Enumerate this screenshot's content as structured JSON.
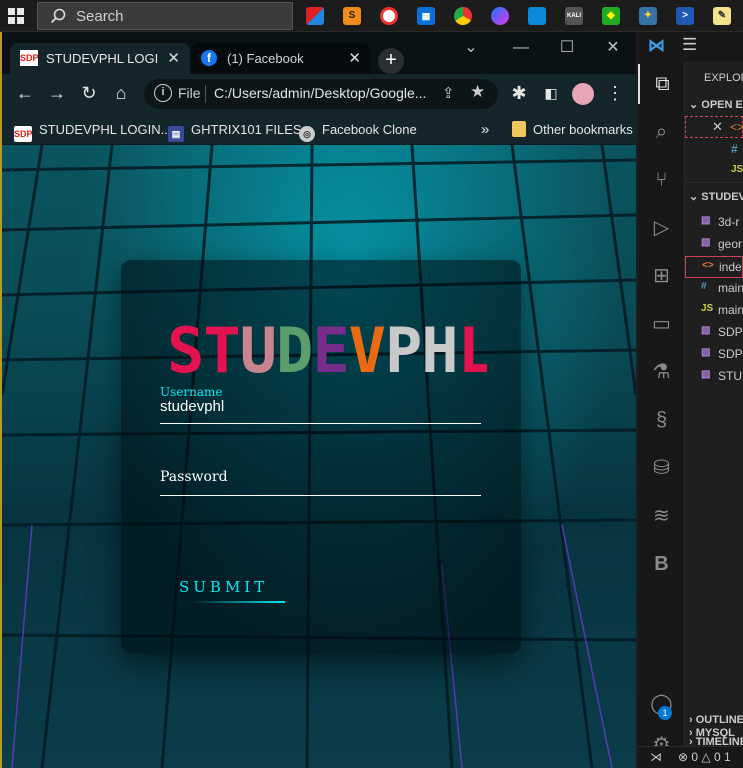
{
  "taskbar": {
    "search_placeholder": "Search"
  },
  "browser": {
    "tabs": [
      {
        "label": "STUDEVPHL LOGIN FO",
        "favicon": "SDP"
      },
      {
        "label": "(1) Facebook"
      }
    ],
    "address": {
      "scheme_label": "File",
      "url": "C:/Users/admin/Desktop/Google..."
    },
    "bookmarks": [
      {
        "label": "STUDEVPHL LOGIN...",
        "favicon": "SDP"
      },
      {
        "label": "GHTRIX101 FILES"
      },
      {
        "label": "Facebook Clone"
      }
    ],
    "bookmarks_overflow": "»",
    "other_bookmarks": "Other bookmarks"
  },
  "login": {
    "logo_letters": [
      {
        "ch": "S",
        "color": "#e3134f"
      },
      {
        "ch": "T",
        "color": "#e3134f"
      },
      {
        "ch": "U",
        "color": "#c9848f"
      },
      {
        "ch": "D",
        "color": "#5c9e6b"
      },
      {
        "ch": "E",
        "color": "#7a2c8c"
      },
      {
        "ch": "V",
        "color": "#e86a12"
      },
      {
        "ch": "P",
        "color": "#c9c9c9"
      },
      {
        "ch": "H",
        "color": "#c9c9c9"
      },
      {
        "ch": "L",
        "color": "#e3134f"
      }
    ],
    "username_label": "Username",
    "username_value": "studevphl",
    "password_label": "Password",
    "submit_label": "SUBMIT"
  },
  "vscode": {
    "explorer_title": "EXPLORER",
    "open_editors_label": "OPEN EDITORS",
    "folder_label": "STUDEVPHL",
    "files": [
      {
        "label": "3d-r",
        "icon": "image-icon"
      },
      {
        "label": "geor",
        "icon": "image-icon"
      },
      {
        "label": "inde",
        "icon": "html-icon"
      },
      {
        "label": "main",
        "icon": "css-icon"
      },
      {
        "label": "main",
        "icon": "js-icon"
      },
      {
        "label": "SDP",
        "icon": "image-icon"
      },
      {
        "label": "SDP",
        "icon": "image-icon"
      },
      {
        "label": "STU",
        "icon": "image-icon"
      }
    ],
    "sections": [
      "OUTLINE",
      "TIMELINE",
      "MYSQL"
    ],
    "account_badge": "1",
    "status_errors": "0",
    "status_warnings": "0",
    "status_other": "1"
  }
}
